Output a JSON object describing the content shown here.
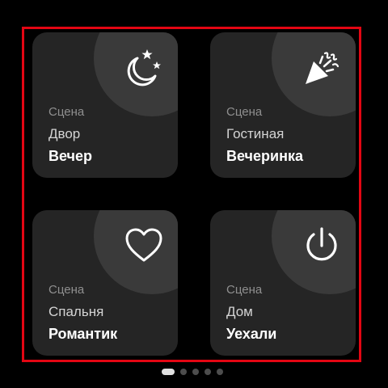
{
  "cards": [
    {
      "caption": "Сцена",
      "room": "Двор",
      "scene": "Вечер",
      "icon": "moon-stars-icon"
    },
    {
      "caption": "Сцена",
      "room": "Гостиная",
      "scene": "Вечеринка",
      "icon": "party-popper-icon"
    },
    {
      "caption": "Сцена",
      "room": "Спальня",
      "scene": "Романтик",
      "icon": "heart-icon"
    },
    {
      "caption": "Сцена",
      "room": "Дом",
      "scene": "Уехали",
      "icon": "power-icon"
    }
  ],
  "pager": {
    "total": 5,
    "active_index": 0
  },
  "colors": {
    "background": "#000000",
    "card": "#252525",
    "card_circle": "#3a3a3a",
    "focus_frame": "#e30613",
    "dot_active": "#e0e0e0",
    "dot_inactive": "#4d4d4d"
  }
}
